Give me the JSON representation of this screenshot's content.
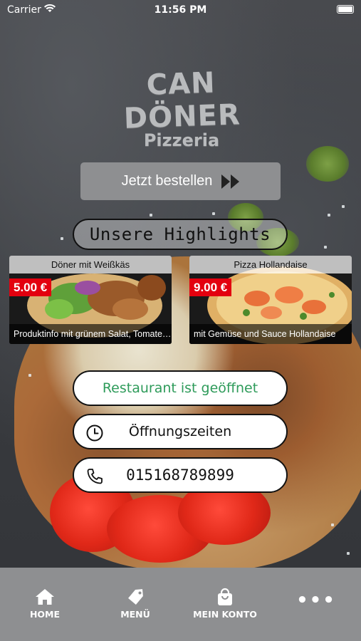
{
  "status_bar": {
    "carrier": "Carrier",
    "time": "11:56 PM"
  },
  "logo": {
    "brand": "CAN DÖNER",
    "sub": "Pizzeria"
  },
  "order_button": {
    "label": "Jetzt bestellen",
    "icon": "double-chevron-right-icon"
  },
  "highlights": {
    "title": "Unsere Highlights"
  },
  "products": [
    {
      "title": "Döner mit Weißkäs",
      "price": "5.00 €",
      "info": "Produktinfo mit grünem Salat, Tomaten..."
    },
    {
      "title": "Pizza Hollandaise",
      "price": "9.00 €",
      "info": "mit Gemüse und Sauce Hollandaise"
    }
  ],
  "status": {
    "open_label": "Restaurant ist geöffnet",
    "open_color": "#2e9b5a"
  },
  "hours": {
    "label": "Öffnungszeiten",
    "icon": "clock-icon"
  },
  "phone": {
    "label": "015168789899",
    "icon": "phone-icon"
  },
  "tabbar": {
    "home": "HOME",
    "menu": "MENÜ",
    "account": "MEIN KONTO",
    "more": "•••"
  },
  "colors": {
    "price_badge": "#e3000f",
    "button_gray": "#8e8f91",
    "tabbar": "#8e8f91"
  }
}
